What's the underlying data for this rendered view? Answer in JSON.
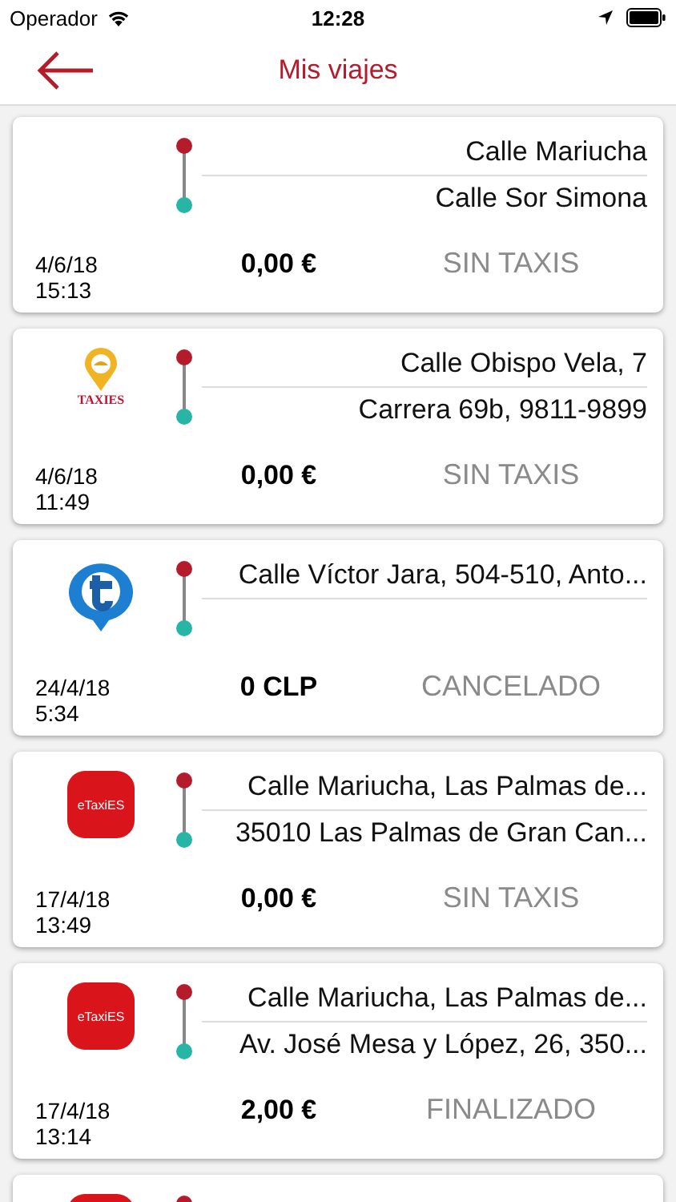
{
  "status_bar": {
    "carrier": "Operador",
    "time": "12:28"
  },
  "nav": {
    "title": "Mis viajes"
  },
  "trips": [
    {
      "logo": {
        "kind": "none"
      },
      "origin": "Calle Mariucha",
      "destination": "Calle Sor Simona",
      "date": "4/6/18",
      "time": "15:13",
      "price": "0,00 €",
      "status": "SIN TAXIS"
    },
    {
      "logo": {
        "kind": "pin",
        "text": "TAXIES"
      },
      "origin": "Calle Obispo Vela, 7",
      "destination": "Carrera 69b, 9811-9899",
      "date": "4/6/18",
      "time": "11:49",
      "price": "0,00 €",
      "status": "SIN TAXIS"
    },
    {
      "logo": {
        "kind": "bubble"
      },
      "origin": "Calle Víctor Jara, 504-510, Anto...",
      "date": "24/4/18",
      "time": "5:34",
      "price": "0 CLP",
      "status": "CANCELADO"
    },
    {
      "logo": {
        "kind": "rounded",
        "text": "eTaxiES"
      },
      "origin": "Calle Mariucha, Las Palmas de...",
      "destination": "35010 Las Palmas de Gran Can...",
      "date": "17/4/18",
      "time": "13:49",
      "price": "0,00 €",
      "status": "SIN TAXIS"
    },
    {
      "logo": {
        "kind": "rounded",
        "text": "eTaxiES"
      },
      "origin": "Calle Mariucha, Las Palmas de...",
      "destination": "Av. José Mesa y López, 26, 350...",
      "date": "17/4/18",
      "time": "13:14",
      "price": "2,00 €",
      "status": "FINALIZADO"
    },
    {
      "logo": {
        "kind": "rounded"
      }
    }
  ]
}
